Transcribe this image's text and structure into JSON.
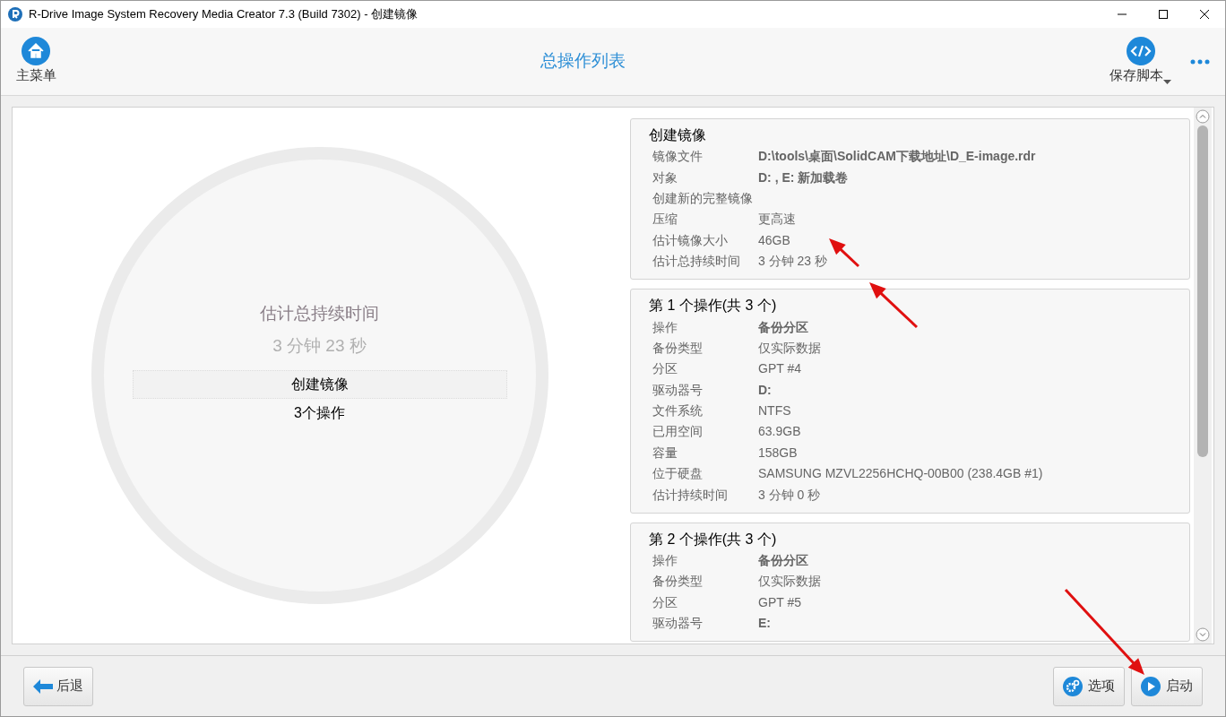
{
  "window": {
    "title": "R-Drive Image System Recovery Media Creator 7.3 (Build 7302) - 创建镜像"
  },
  "toolbar": {
    "main_menu": "主菜单",
    "title": "总操作列表",
    "save_script": "保存脚本"
  },
  "summary": {
    "heading": "估计总持续时间",
    "duration": "3 分钟 23 秒",
    "items": [
      {
        "label": "创建镜像",
        "selected": true
      },
      {
        "label": "3个操作",
        "selected": false
      }
    ]
  },
  "cards": [
    {
      "title": "创建镜像",
      "rows": [
        {
          "label": "镜像文件",
          "value": "D:\\tools\\桌面\\SolidCAM下载地址\\D_E-image.rdr",
          "bold": true
        },
        {
          "label": "对象",
          "value": "D: , E: 新加载卷",
          "bold": true
        },
        {
          "label": "创建新的完整镜像"
        },
        {
          "label": "压缩",
          "value": "更高速",
          "bold": false
        },
        {
          "label": "估计镜像大小",
          "value": "46GB",
          "bold": false
        },
        {
          "label": "估计总持续时间",
          "value": "3 分钟 23 秒",
          "bold": false
        }
      ]
    },
    {
      "title": "第 1 个操作(共 3 个)",
      "rows": [
        {
          "label": "操作",
          "value": "备份分区",
          "bold": true
        },
        {
          "label": "备份类型",
          "value": "仅实际数据",
          "bold": false
        },
        {
          "label": "分区",
          "value": "GPT #4",
          "bold": false
        },
        {
          "label": "驱动器号",
          "value": "D:",
          "bold": true
        },
        {
          "label": "文件系统",
          "value": "NTFS",
          "bold": false
        },
        {
          "label": "已用空间",
          "value": "63.9GB",
          "bold": false
        },
        {
          "label": "容量",
          "value": "158GB",
          "bold": false
        },
        {
          "label": "位于硬盘",
          "value": "SAMSUNG MZVL2256HCHQ-00B00 (238.4GB #1)",
          "bold": false
        },
        {
          "label": "估计持续时间",
          "value": "3 分钟 0 秒",
          "bold": false
        }
      ]
    },
    {
      "title": "第 2 个操作(共 3 个)",
      "rows": [
        {
          "label": "操作",
          "value": "备份分区",
          "bold": true
        },
        {
          "label": "备份类型",
          "value": "仅实际数据",
          "bold": false
        },
        {
          "label": "分区",
          "value": "GPT #5",
          "bold": false
        },
        {
          "label": "驱动器号",
          "value": "E:",
          "bold": true
        }
      ]
    }
  ],
  "footer": {
    "back": "后退",
    "options": "选项",
    "start": "启动"
  }
}
